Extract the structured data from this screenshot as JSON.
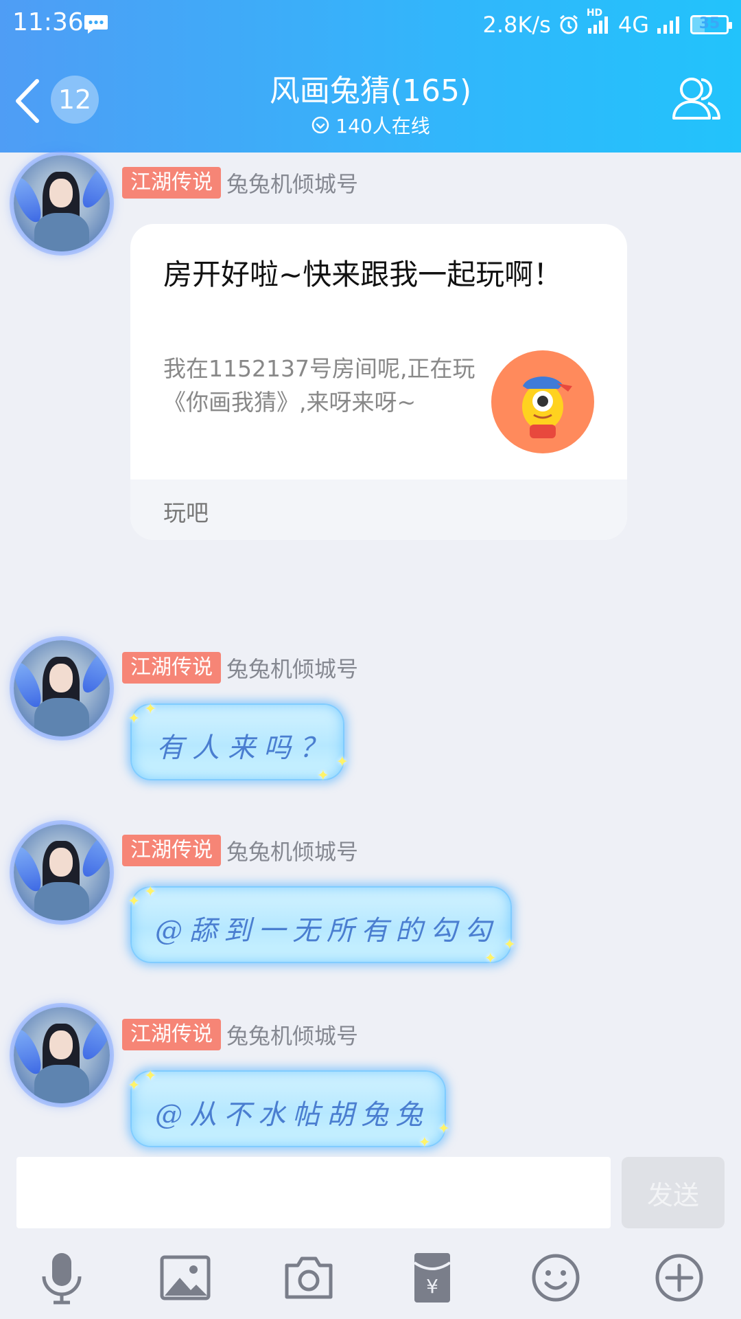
{
  "status_bar": {
    "time": "11:36",
    "network_speed": "2.8K/s",
    "network_type": "4G",
    "hd_label": "HD",
    "battery_level": "35",
    "battery_fraction": 0.35
  },
  "header": {
    "back_badge_count": "12",
    "group_title": "风画兔猜(165)",
    "online_status": "140人在线"
  },
  "messages": [
    {
      "type": "share_card",
      "rank": "江湖传说",
      "sender": "兔兔机倾城号",
      "card_title": "房开好啦~快来跟我一起玩啊！",
      "card_desc": "我在1152137号房间呢,正在玩《你画我猜》,来呀来呀~",
      "card_footer": "玩吧"
    },
    {
      "type": "text",
      "rank": "江湖传说",
      "sender": "兔兔机倾城号",
      "text": "有人来吗？"
    },
    {
      "type": "text",
      "rank": "江湖传说",
      "sender": "兔兔机倾城号",
      "text": "@舔到一无所有的勾勾"
    },
    {
      "type": "text",
      "rank": "江湖传说",
      "sender": "兔兔机倾城号",
      "text": "@从不水帖胡兔兔"
    }
  ],
  "input": {
    "placeholder": "",
    "send_label": "发送"
  },
  "toolbar_icons": [
    "microphone-icon",
    "image-icon",
    "camera-icon",
    "red-packet-icon",
    "emoji-icon",
    "plus-icon"
  ],
  "colors": {
    "header_gradient_start": "#4f9df5",
    "header_gradient_end": "#22c3fb",
    "rank_badge": "#f68576",
    "background": "#eef0f6"
  }
}
